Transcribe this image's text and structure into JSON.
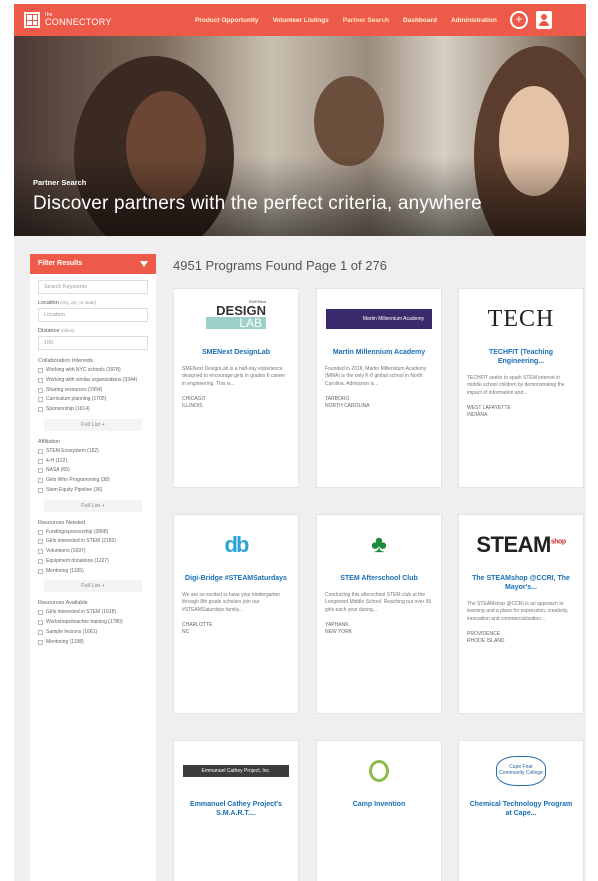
{
  "header": {
    "logo_text": "CONNECTORY",
    "logo_small": "the",
    "nav": [
      "Product Opportunity",
      "Volunteer Listings",
      "Partner Search",
      "Dashboard",
      "Administration"
    ],
    "add_icon": "plus-icon",
    "user_icon": "user-icon"
  },
  "hero": {
    "subtitle": "Partner Search",
    "title": "Discover partners with the perfect criteria, anywhere"
  },
  "sidebar": {
    "filter_label": "Filter Results",
    "search_placeholder": "Search Keywords",
    "location_label": "Location",
    "location_hint": "(city, zip, or state)",
    "location_placeholder": "Location",
    "distance_label": "Distance",
    "distance_hint": "(miles)",
    "distance_value": "100",
    "collab_label": "Collaboration Interests",
    "collab": [
      "Working with NYC schools (3978)",
      "Working with similar organizations (3344)",
      "Sharing resources (1954)",
      "Curriculum planning (1705)",
      "Sponsorship (1614)"
    ],
    "full_list": "Full List +",
    "affiliation_label": "Affiliation",
    "affiliation": [
      "STEM Ecosystem (152)",
      "4-H (122)",
      "NASA (65)",
      "Girls Who Programming (38)",
      "Stem Equity Pipeline (36)"
    ],
    "resources_needed_label": "Resources Needed",
    "resources_needed": [
      "Funding/sponsorship (2808)",
      "Girls interested in STEM (2182)",
      "Volunteers (1697)",
      "Equipment donations (1227)",
      "Mentoring (1105)"
    ],
    "resources_available_label": "Resources Available",
    "resources_available": [
      "Girls interested in STEM (1918)",
      "Workshops/teacher training (1780)",
      "Sample lessons (1661)",
      "Mentoring (1198)"
    ]
  },
  "results": {
    "count_text": "4951 Programs Found",
    "page_text": "Page 1 of 276"
  },
  "cards": [
    {
      "title": "SMENext DesignLab",
      "desc": "SMENext DesignLab is a half-day experience designed to encourage girls in grades 6 career in engineering. This is...",
      "loc1": "Chicago",
      "loc2": "Illinois",
      "logo_small": "SWENext",
      "logo_mid": "DESIGN",
      "logo_big": "LAB"
    },
    {
      "title": "Martin Millennium Academy",
      "desc": "Founded in 2016, Martin Millennium Academy (MMA) is the only K-8 global school in North Carolina. Admission is...",
      "loc1": "Tarboro",
      "loc2": "North Carolina",
      "logo_text": "Martin Millennium Academy"
    },
    {
      "title": "TECHFIT (Teaching Engineering...",
      "desc": "TECHFIT seeks to spark STEM interest in middle school children by demonstrating the impact of information and...",
      "loc1": "West Lafayette",
      "loc2": "Indiana",
      "logo_text": "TECH"
    },
    {
      "title": "Digi-Bridge #STEAMSaturdays",
      "desc": "We are so excited to have your kindergarten through 8th grade scholars join our #STEAMSaturdays family...",
      "loc1": "Charlotte",
      "loc2": "NC",
      "logo_text": "db"
    },
    {
      "title": "STEM Afterschool Club",
      "desc": "Conducting this afterschool STEM club at the Longwood Middle School. Reaching out over 65 girls each year during...",
      "loc1": "Yaphank",
      "loc2": "New York",
      "logo_text": "4-H"
    },
    {
      "title": "The STEAMshop @CCRI, The Mayor's...",
      "desc": "The STEAMshop @CCRI is an approach to learning and a place for expression, creativity, innovation and commercialization...",
      "loc1": "Providence",
      "loc2": "Rhode Island",
      "logo_text": "STEAM",
      "logo_sup": "shop"
    },
    {
      "title": "Emmanuel Cathey Project's S.M.A.R.T....",
      "desc": "",
      "loc1": "",
      "loc2": "",
      "logo_text": "Emmanuel Cathey Project, Inc."
    },
    {
      "title": "Camp Invention",
      "desc": "",
      "loc1": "",
      "loc2": "",
      "logo_text": "Camp Invention"
    },
    {
      "title": "Chemical Technology Program at Cape...",
      "desc": "",
      "loc1": "",
      "loc2": "",
      "logo_text": "Cape Fear Community College"
    }
  ],
  "colors": {
    "accent": "#ee5a4a",
    "link": "#1a6fb7",
    "background": "#efefef"
  }
}
